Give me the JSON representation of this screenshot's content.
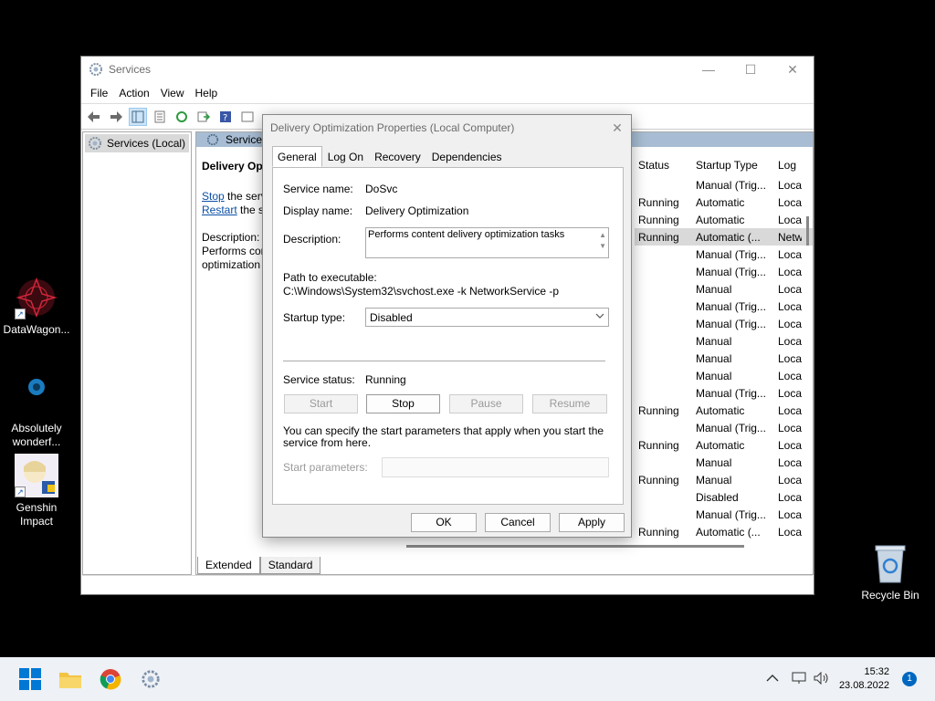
{
  "desktop": {
    "icons": [
      {
        "label": "DataWagon..."
      },
      {
        "label": "Absolutely wonderf..."
      },
      {
        "label": "Genshin Impact"
      }
    ],
    "recycle_bin": "Recycle Bin"
  },
  "services_window": {
    "title": "Services",
    "menu": [
      "File",
      "Action",
      "View",
      "Help"
    ],
    "tree_item": "Services (Local)",
    "pane_header": "Service",
    "selected_service": "Delivery Opt",
    "stop_link": "Stop",
    "stop_rest": " the serv",
    "restart_link": "Restart",
    "restart_rest": " the se",
    "description_label": "Description:",
    "description_line1": "Performs cor",
    "description_line2": "optimization",
    "columns": {
      "status": "Status",
      "startup": "Startup Type",
      "log": "Log"
    },
    "rows": [
      {
        "status": "",
        "startup": "Manual (Trig...",
        "log": "Loca"
      },
      {
        "status": "Running",
        "startup": "Automatic",
        "log": "Loca"
      },
      {
        "status": "Running",
        "startup": "Automatic",
        "log": "Loca"
      },
      {
        "status": "Running",
        "startup": "Automatic (...",
        "log": "Netw"
      },
      {
        "status": "",
        "startup": "Manual (Trig...",
        "log": "Loca"
      },
      {
        "status": "",
        "startup": "Manual (Trig...",
        "log": "Loca"
      },
      {
        "status": "",
        "startup": "Manual",
        "log": "Loca"
      },
      {
        "status": "",
        "startup": "Manual (Trig...",
        "log": "Loca"
      },
      {
        "status": "",
        "startup": "Manual (Trig...",
        "log": "Loca"
      },
      {
        "status": "",
        "startup": "Manual",
        "log": "Loca"
      },
      {
        "status": "",
        "startup": "Manual",
        "log": "Loca"
      },
      {
        "status": "",
        "startup": "Manual",
        "log": "Loca"
      },
      {
        "status": "",
        "startup": "Manual (Trig...",
        "log": "Loca"
      },
      {
        "status": "Running",
        "startup": "Automatic",
        "log": "Loca"
      },
      {
        "status": "",
        "startup": "Manual (Trig...",
        "log": "Loca"
      },
      {
        "status": "Running",
        "startup": "Automatic",
        "log": "Loca"
      },
      {
        "status": "",
        "startup": "Manual",
        "log": "Loca"
      },
      {
        "status": "Running",
        "startup": "Manual",
        "log": "Loca"
      },
      {
        "status": "",
        "startup": "Disabled",
        "log": "Loca"
      },
      {
        "status": "",
        "startup": "Manual (Trig...",
        "log": "Loca"
      },
      {
        "status": "Running",
        "startup": "Automatic (...",
        "log": "Loca"
      }
    ],
    "view_tabs": [
      "Extended",
      "Standard"
    ]
  },
  "dialog": {
    "title": "Delivery Optimization Properties (Local Computer)",
    "tabs": [
      "General",
      "Log On",
      "Recovery",
      "Dependencies"
    ],
    "service_name_label": "Service name:",
    "service_name": "DoSvc",
    "display_name_label": "Display name:",
    "display_name": "Delivery Optimization",
    "description_label": "Description:",
    "description": "Performs content delivery optimization tasks",
    "path_label": "Path to executable:",
    "path": "C:\\Windows\\System32\\svchost.exe -k NetworkService -p",
    "startup_type_label": "Startup type:",
    "startup_type": "Disabled",
    "service_status_label": "Service status:",
    "service_status": "Running",
    "buttons": {
      "start": "Start",
      "stop": "Stop",
      "pause": "Pause",
      "resume": "Resume"
    },
    "help_text": "You can specify the start parameters that apply when you start the service from here.",
    "start_params_label": "Start parameters:",
    "ok": "OK",
    "cancel": "Cancel",
    "apply": "Apply"
  },
  "taskbar": {
    "time": "15:32",
    "date": "23.08.2022",
    "notifications": "1"
  }
}
